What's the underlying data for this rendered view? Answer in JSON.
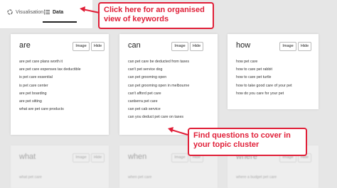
{
  "tabs": {
    "visualisation": "Visualisation",
    "data": "Data"
  },
  "callouts": {
    "top": "Click here for an organised view of keywords",
    "bottom": "Find questions to cover in your topic cluster"
  },
  "colors": {
    "accent": "#e01e37"
  },
  "cards": [
    {
      "keyword": "are",
      "image_label": "Image",
      "hide_label": "Hide",
      "items": [
        "are pet care plans worth it",
        "are pet care expenses tax deductible",
        "is pet care essential",
        "is pet care center",
        "are pet boarding",
        "are pet sitting",
        "what are pet care products"
      ]
    },
    {
      "keyword": "can",
      "image_label": "Image",
      "hide_label": "Hide",
      "items": [
        "can pet care be deducted from taxes",
        "can't pet service dog",
        "can pet grooming open",
        "can pet grooming open in melbourne",
        "can't afford pet care",
        "canberra pet care",
        "can pet cab service",
        "can you deduct pet care on taxes"
      ]
    },
    {
      "keyword": "how",
      "image_label": "Image",
      "hide_label": "Hide",
      "items": [
        "how pet care",
        "how to care pet rabbit",
        "how to care pet turtle",
        "how to take good care of your pet",
        "how do you care for your pet"
      ]
    }
  ],
  "faded_cards": [
    {
      "keyword": "what",
      "image_label": "Image",
      "hide_label": "Hide",
      "items": [
        "what pet care"
      ]
    },
    {
      "keyword": "when",
      "image_label": "Image",
      "hide_label": "Hide",
      "items": [
        "when pet care"
      ]
    },
    {
      "keyword": "where",
      "image_label": "Image",
      "hide_label": "Hide",
      "items": [
        "where a budget pet care"
      ]
    }
  ]
}
